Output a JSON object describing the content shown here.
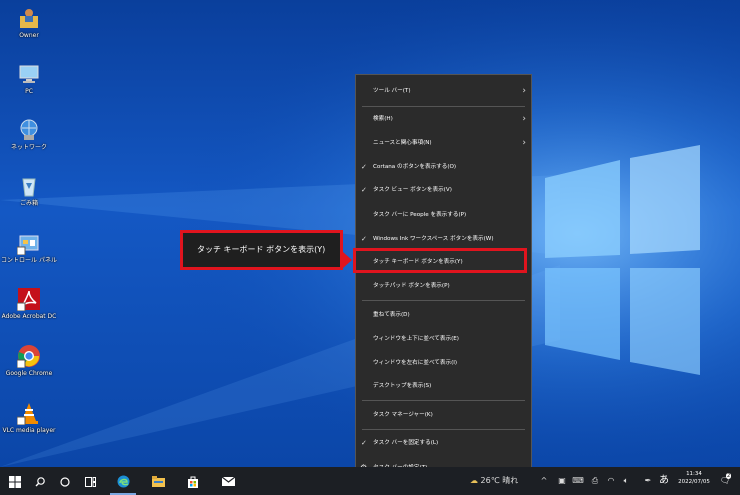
{
  "desktop_icons": [
    {
      "label": "Owner"
    },
    {
      "label": "PC"
    },
    {
      "label": "ネットワーク"
    },
    {
      "label": "ごみ箱"
    },
    {
      "label": "コントロール パネル"
    },
    {
      "label": "Adobe Acrobat DC"
    },
    {
      "label": "Google Chrome"
    },
    {
      "label": "VLC media player"
    }
  ],
  "context_menu": {
    "items": [
      {
        "label": "ツール バー(T)",
        "has_submenu": true,
        "checked": false
      },
      {
        "label": "検索(H)",
        "has_submenu": true,
        "checked": false
      },
      {
        "label": "ニュースと関心事項(N)",
        "has_submenu": true,
        "checked": false
      },
      {
        "label": "Cortana のボタンを表示する(O)",
        "has_submenu": false,
        "checked": true
      },
      {
        "label": "タスク ビュー ボタンを表示(V)",
        "has_submenu": false,
        "checked": true
      },
      {
        "label": "タスク バーに People を表示する(P)",
        "has_submenu": false,
        "checked": false
      },
      {
        "label": "Windows Ink ワークスペース ボタンを表示(W)",
        "has_submenu": false,
        "checked": true
      },
      {
        "label": "タッチ キーボード ボタンを表示(Y)",
        "has_submenu": false,
        "checked": false,
        "highlighted": true
      },
      {
        "label": "タッチパッド ボタンを表示(P)",
        "has_submenu": false,
        "checked": false
      },
      {
        "label": "重ねて表示(D)"
      },
      {
        "label": "ウィンドウを上下に並べて表示(E)"
      },
      {
        "label": "ウィンドウを左右に並べて表示(I)"
      },
      {
        "label": "デスクトップを表示(S)"
      },
      {
        "label": "タスク マネージャー(K)"
      },
      {
        "label": "タスク バーを固定する(L)",
        "checked": true
      },
      {
        "label": "タスク バーの設定(T)",
        "icon": "gear-icon"
      }
    ]
  },
  "callout": {
    "text": "タッチ キーボード ボタンを表示(Y)",
    "border_color": "#e0141e"
  },
  "taskbar": {
    "weather": "26℃ 晴れ",
    "ime": "あ",
    "time": "11:34",
    "date": "2022/07/05",
    "notification_count": "2"
  },
  "colors": {
    "desktop": "#1458c4",
    "menu_bg": "#2b2b2b",
    "taskbar_bg": "#1c1f24",
    "accent": "#e0141e"
  }
}
